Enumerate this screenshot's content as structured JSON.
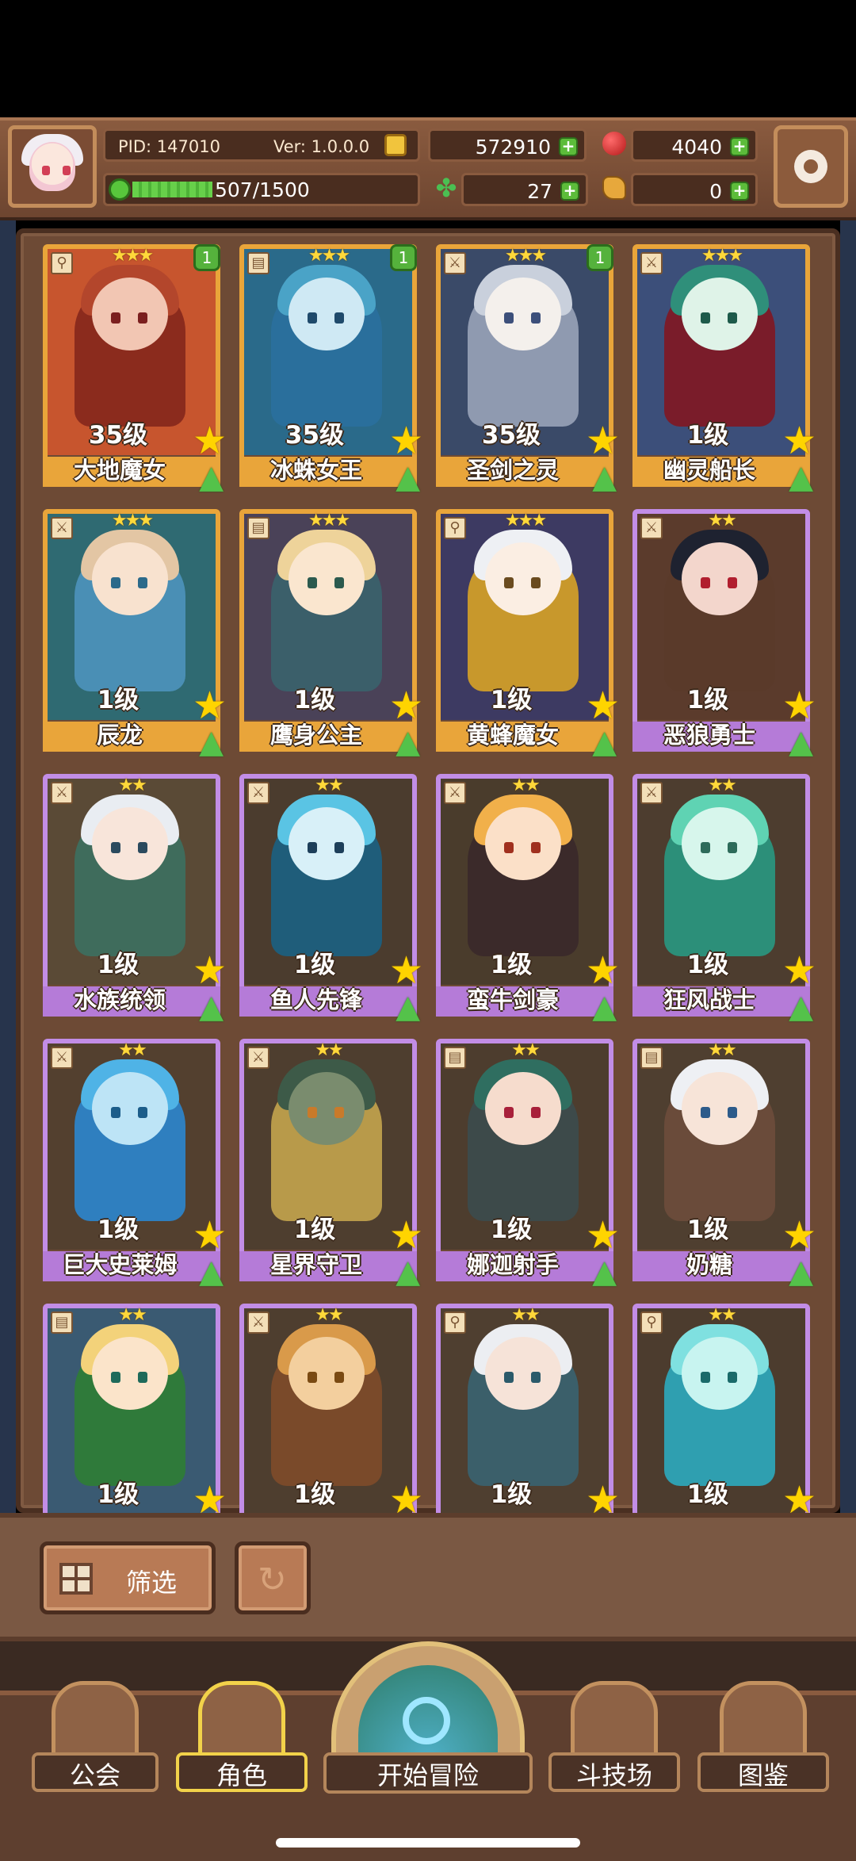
{
  "header": {
    "pid": "PID: 147010",
    "version": "Ver: 1.0.0.0",
    "gold": "572910",
    "ruby": "4040",
    "clover": "27",
    "bread": "0",
    "xp": "507/1500",
    "xp_progress": 0.338
  },
  "cards": [
    {
      "level": "35级",
      "name": "大地魔女",
      "stars": "★★★",
      "badge": "1",
      "frame": "gold",
      "weapon": "staff"
    },
    {
      "level": "35级",
      "name": "冰蛛女王",
      "stars": "★★★",
      "badge": "1",
      "frame": "gold",
      "weapon": "book"
    },
    {
      "level": "35级",
      "name": "圣剑之灵",
      "stars": "★★★",
      "badge": "1",
      "frame": "gold",
      "weapon": "sword"
    },
    {
      "level": "1级",
      "name": "幽灵船长",
      "stars": "★★★",
      "badge": "",
      "frame": "gold",
      "weapon": "sword"
    },
    {
      "level": "1级",
      "name": "辰龙",
      "stars": "★★★",
      "badge": "",
      "frame": "gold",
      "weapon": "sword"
    },
    {
      "level": "1级",
      "name": "鹰身公主",
      "stars": "★★★",
      "badge": "",
      "frame": "gold",
      "weapon": "book"
    },
    {
      "level": "1级",
      "name": "黄蜂魔女",
      "stars": "★★★",
      "badge": "",
      "frame": "gold",
      "weapon": "staff"
    },
    {
      "level": "1级",
      "name": "恶狼勇士",
      "stars": "★★",
      "badge": "",
      "frame": "purple",
      "weapon": "sword"
    },
    {
      "level": "1级",
      "name": "水族统领",
      "stars": "★★",
      "badge": "",
      "frame": "purple",
      "weapon": "sword"
    },
    {
      "level": "1级",
      "name": "鱼人先锋",
      "stars": "★★",
      "badge": "",
      "frame": "purple",
      "weapon": "sword"
    },
    {
      "level": "1级",
      "name": "蛮牛剑豪",
      "stars": "★★",
      "badge": "",
      "frame": "purple",
      "weapon": "sword"
    },
    {
      "level": "1级",
      "name": "狂风战士",
      "stars": "★★",
      "badge": "",
      "frame": "purple",
      "weapon": "sword"
    },
    {
      "level": "1级",
      "name": "巨大史莱姆",
      "stars": "★★",
      "badge": "",
      "frame": "purple",
      "weapon": "sword"
    },
    {
      "level": "1级",
      "name": "星界守卫",
      "stars": "★★",
      "badge": "",
      "frame": "purple",
      "weapon": "sword"
    },
    {
      "level": "1级",
      "name": "娜迦射手",
      "stars": "★★",
      "badge": "",
      "frame": "purple",
      "weapon": "book"
    },
    {
      "level": "1级",
      "name": "奶糖",
      "stars": "★★",
      "badge": "",
      "frame": "purple",
      "weapon": "book"
    },
    {
      "level": "1级",
      "name": "",
      "stars": "★★",
      "badge": "",
      "frame": "purple",
      "weapon": "book"
    },
    {
      "level": "1级",
      "name": "",
      "stars": "★★",
      "badge": "",
      "frame": "purple",
      "weapon": "sword"
    },
    {
      "level": "1级",
      "name": "",
      "stars": "★★",
      "badge": "",
      "frame": "purple",
      "weapon": "staff"
    },
    {
      "level": "1级",
      "name": "",
      "stars": "★★",
      "badge": "",
      "frame": "purple",
      "weapon": "staff"
    }
  ],
  "filter": {
    "label": "筛选"
  },
  "nav": {
    "guild": "公会",
    "characters": "角色",
    "adventure": "开始冒险",
    "arena": "斗技场",
    "codex": "图鉴"
  },
  "colors": {
    "gold_frame": "#e9a53a",
    "purple_frame": "#c28de6",
    "accent_green": "#5cbc3a"
  }
}
